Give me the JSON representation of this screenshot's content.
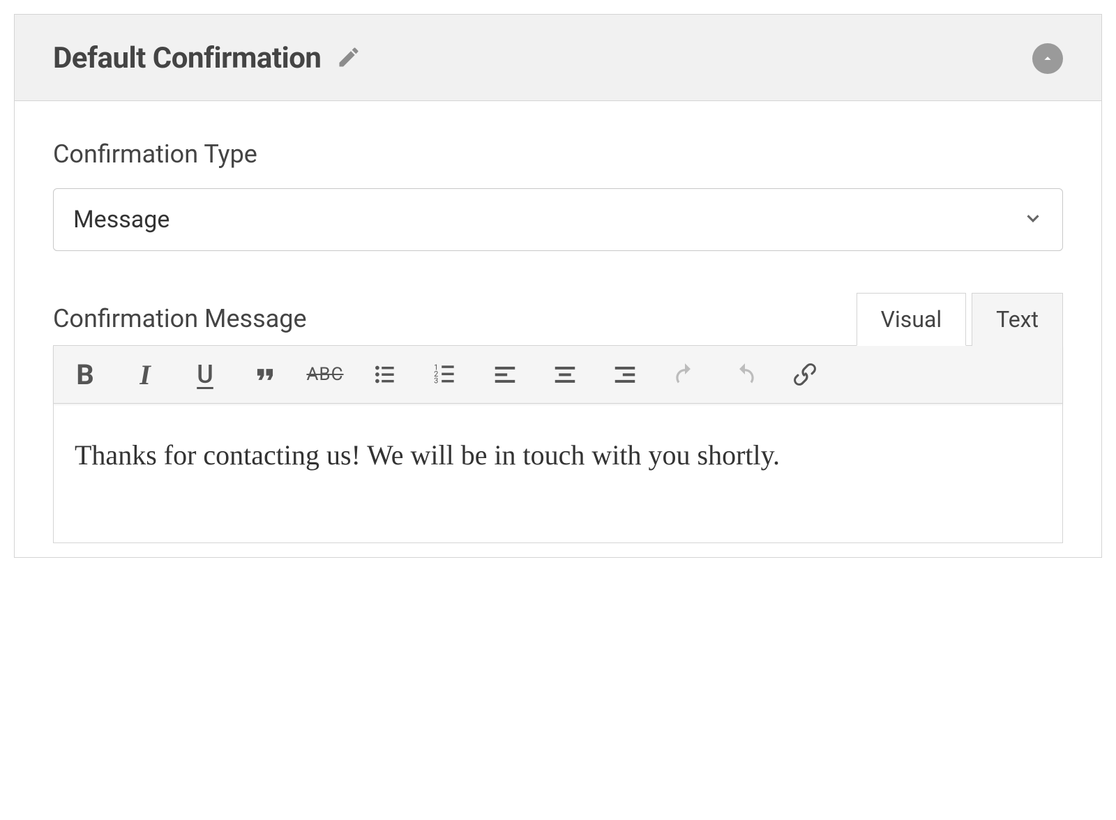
{
  "panel": {
    "title": "Default Confirmation"
  },
  "form": {
    "type_label": "Confirmation Type",
    "type_value": "Message",
    "message_label": "Confirmation Message"
  },
  "editor": {
    "tabs": {
      "visual": "Visual",
      "text": "Text"
    },
    "content": "Thanks for contacting us! We will be in touch with you shortly."
  },
  "toolbar": {
    "bold": "B",
    "italic": "I",
    "underline": "U",
    "strike": "ABC"
  }
}
